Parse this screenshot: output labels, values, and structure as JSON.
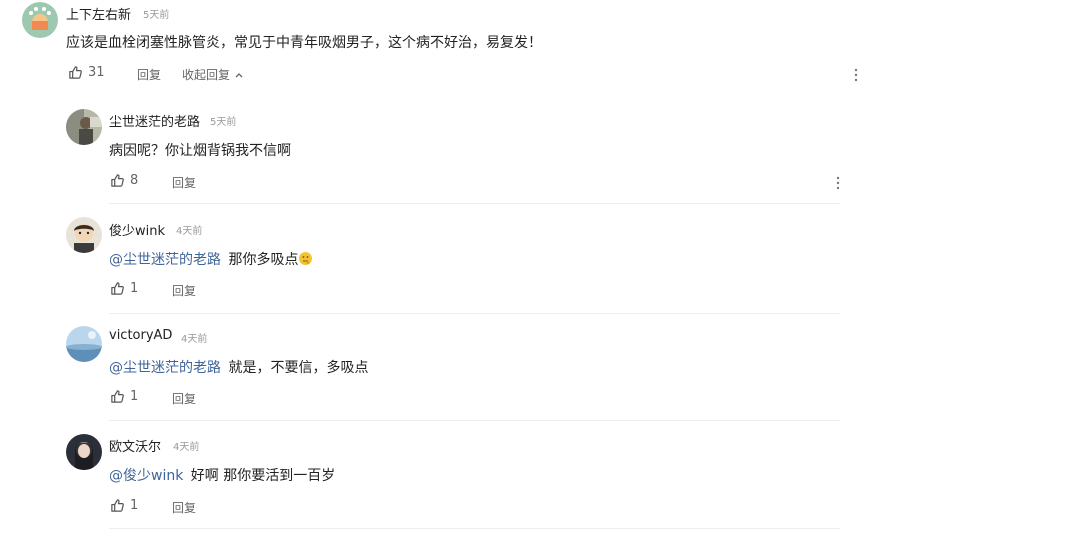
{
  "comments": [
    {
      "username": "上下左右新",
      "time": "5天前",
      "mention": "",
      "text": "应该是血栓闭塞性脉管炎，常见于中青年吸烟男子，这个病不好治，易复发！",
      "likes": "31",
      "reply_label": "回复",
      "collapse_label": "收起回复"
    },
    {
      "username": "尘世迷茫的老路",
      "time": "5天前",
      "mention": "",
      "text": "病因呢？你让烟背锅我不信啊",
      "likes": "8",
      "reply_label": "回复"
    },
    {
      "username": "俊少wink",
      "time": "4天前",
      "mention": "@尘世迷茫的老路",
      "text": "那你多吸点",
      "emoji": "thinking-emoji",
      "likes": "1",
      "reply_label": "回复"
    },
    {
      "username": "victoryAD",
      "time": "4天前",
      "mention": "@尘世迷茫的老路",
      "text": "就是，不要信，多吸点",
      "likes": "1",
      "reply_label": "回复"
    },
    {
      "username": "欧文沃尔",
      "time": "4天前",
      "mention": "@俊少wink",
      "text": "好啊 那你要活到一百岁",
      "likes": "1",
      "reply_label": "回复"
    }
  ],
  "colors": {
    "mention": "#406599",
    "muted": "#999999",
    "action": "#666666",
    "divider": "#eeeeee"
  }
}
